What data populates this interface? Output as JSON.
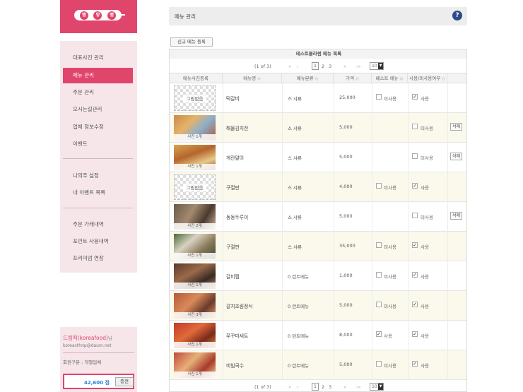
{
  "logo": {
    "chars": [
      "맵",
      "양",
      "맵"
    ]
  },
  "sidebar": {
    "items": [
      {
        "label": "대표사진 관리"
      },
      {
        "label": "메뉴 관리"
      },
      {
        "label": "주문 관리"
      },
      {
        "label": "오시는길관리"
      },
      {
        "label": "업체 정보수정"
      },
      {
        "label": "이벤트"
      },
      {
        "label": "나의주 설정"
      },
      {
        "label": "내 이벤트 목록"
      },
      {
        "label": "주문 가래내역"
      },
      {
        "label": "포인트 사용내역"
      },
      {
        "label": "프리미엄 연장"
      }
    ]
  },
  "user": {
    "name": "드림떡(koreafood)",
    "name_suffix": "님",
    "email": "koreacthnp@daum.net",
    "type_label": "회원구분",
    "type_value": "개별업체",
    "points": "42,600 점",
    "charge_label": "충전"
  },
  "header": {
    "title": "메뉴 관리",
    "help_icon": "?"
  },
  "toolbar": {
    "new_label": "신규 메뉴 등록"
  },
  "grid": {
    "title": "테스트블라썸 메뉴 목록",
    "pager": {
      "info": "(1 of 3)",
      "first": "«",
      "prev": "‹",
      "pages": [
        "1",
        "2",
        "3"
      ],
      "next": "»",
      "last": "›»",
      "per_page": "10",
      "dropdown": "▼"
    },
    "columns": [
      "메뉴사진등록",
      "메뉴명",
      "메뉴분류",
      "가격",
      "베스트 메뉴",
      "사용/미사용여부",
      ""
    ],
    "sort_icon": "◇",
    "no_image_label": "그림없음",
    "best_on_label": "사용",
    "best_off_label": "미사용",
    "use_label": "사용",
    "unuse_label": "미사용",
    "delete_label": "삭제",
    "check_mark": "✓",
    "rows": [
      {
        "photo": "none",
        "caption": "",
        "name": "떡갈비",
        "category": "스 샤류",
        "price": "25,000",
        "best": "off",
        "use": true,
        "delete": false
      },
      {
        "photo": "dish1",
        "caption": "사진 1개",
        "name": "해물김치전",
        "category": "스 샤류",
        "price": "5,000",
        "best": "",
        "use": false,
        "delete": true
      },
      {
        "photo": "dish2",
        "caption": "사진 1개",
        "name": "계란말이",
        "category": "스 샤류",
        "price": "5,000",
        "best": "",
        "use": false,
        "delete": true
      },
      {
        "photo": "none",
        "caption": "",
        "name": "구절판",
        "category": "스 샤류",
        "price": "4,000",
        "best": "off",
        "use": true,
        "delete": false
      },
      {
        "photo": "dish3",
        "caption": "사진 2개",
        "name": "동동두루이",
        "category": "스 샤류",
        "price": "5,000",
        "best": "",
        "use": false,
        "delete": true
      },
      {
        "photo": "dish4",
        "caption": "사진 1개",
        "name": "구절판",
        "category": "스 샤류",
        "price": "35,000",
        "best": "off",
        "use": true,
        "delete": false
      },
      {
        "photo": "dish5",
        "caption": "사진 1개",
        "name": "갈비찜",
        "category": "0 런트메뉴",
        "price": "1,000",
        "best": "off",
        "use": true,
        "delete": false
      },
      {
        "photo": "dish6",
        "caption": "사진 3개",
        "name": "갈치조림정식",
        "category": "0 런트메뉴",
        "price": "5,000",
        "best": "off",
        "use": true,
        "delete": false
      },
      {
        "photo": "dish7",
        "caption": "사진 1개",
        "name": "쭈꾸미세트",
        "category": "0 런트메뉴",
        "price": "8,000",
        "best": "on",
        "use": true,
        "delete": false
      },
      {
        "photo": "dish8",
        "caption": "사진 1개",
        "name": "비빔국수",
        "category": "0 런트메뉴",
        "price": "5,000",
        "best": "off",
        "use": true,
        "delete": false
      }
    ]
  }
}
